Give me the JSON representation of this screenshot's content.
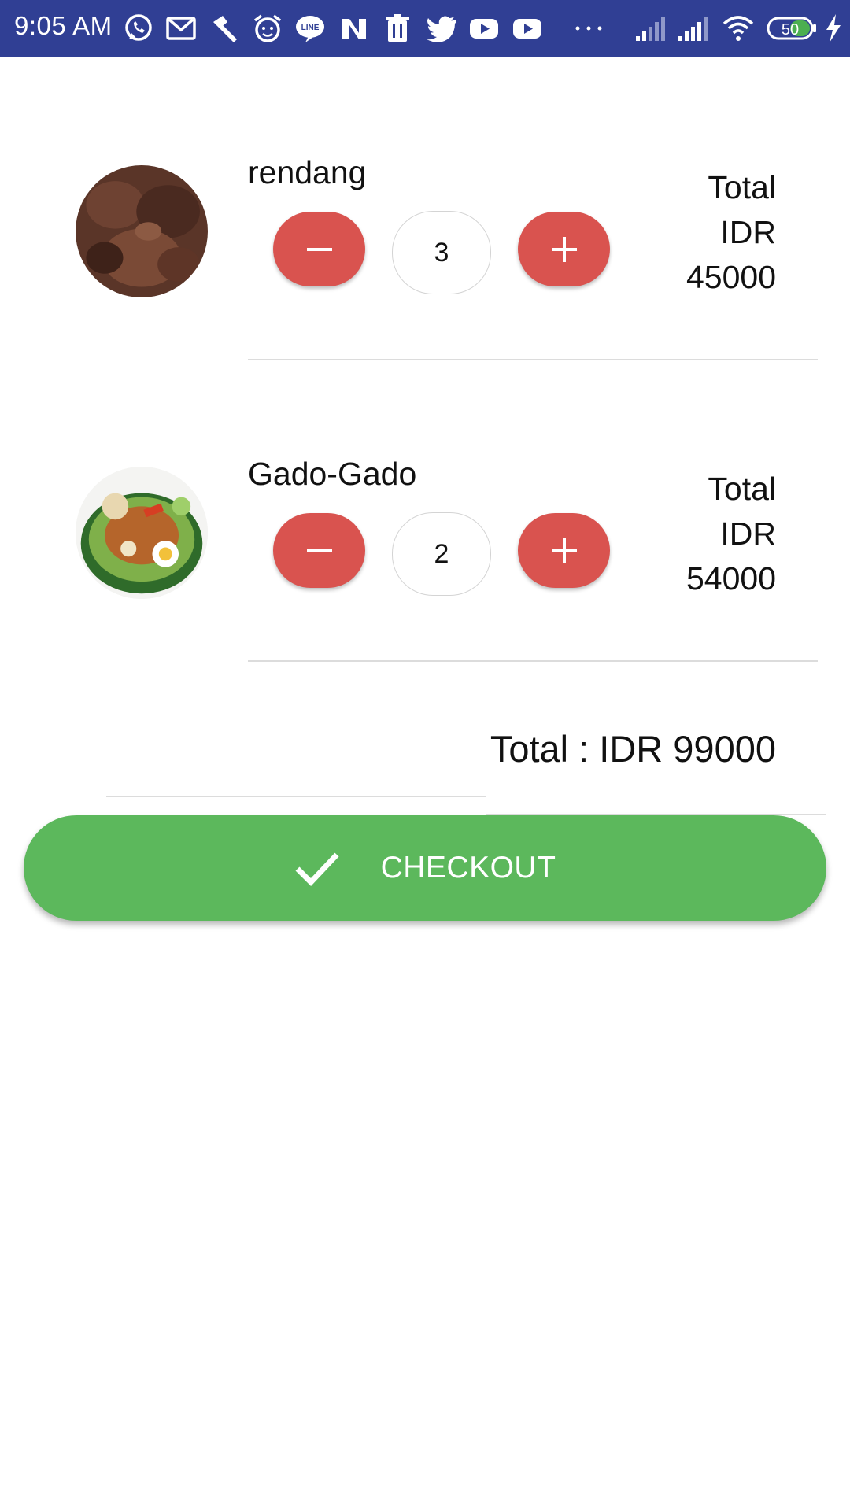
{
  "status_bar": {
    "time": "9:05 AM",
    "battery": "50",
    "notification_icons": [
      "whatsapp-icon",
      "gmail-icon",
      "tool-icon",
      "alarm-icon",
      "line-icon",
      "news-icon",
      "trash-icon",
      "twitter-icon",
      "youtube-icon",
      "youtube-icon",
      "more-icon"
    ],
    "system_icons": [
      "signal-icon",
      "signal-icon",
      "wifi-icon",
      "battery-icon",
      "charging-icon"
    ]
  },
  "cart": {
    "items": [
      {
        "name": "rendang",
        "quantity": "3",
        "total_label": "Total",
        "currency": "IDR",
        "total_value": "45000",
        "decrease_icon": "minus-icon",
        "increase_icon": "plus-icon"
      },
      {
        "name": "Gado-Gado",
        "quantity": "2",
        "total_label": "Total",
        "currency": "IDR",
        "total_value": "54000",
        "decrease_icon": "minus-icon",
        "increase_icon": "plus-icon"
      }
    ],
    "grand_total": "Total : IDR 99000"
  },
  "checkout": {
    "label": "CHECKOUT",
    "icon": "check-icon"
  },
  "colors": {
    "status_bar": "#303f94",
    "qty_button": "#d9534f",
    "checkout_button": "#5cb85c"
  }
}
